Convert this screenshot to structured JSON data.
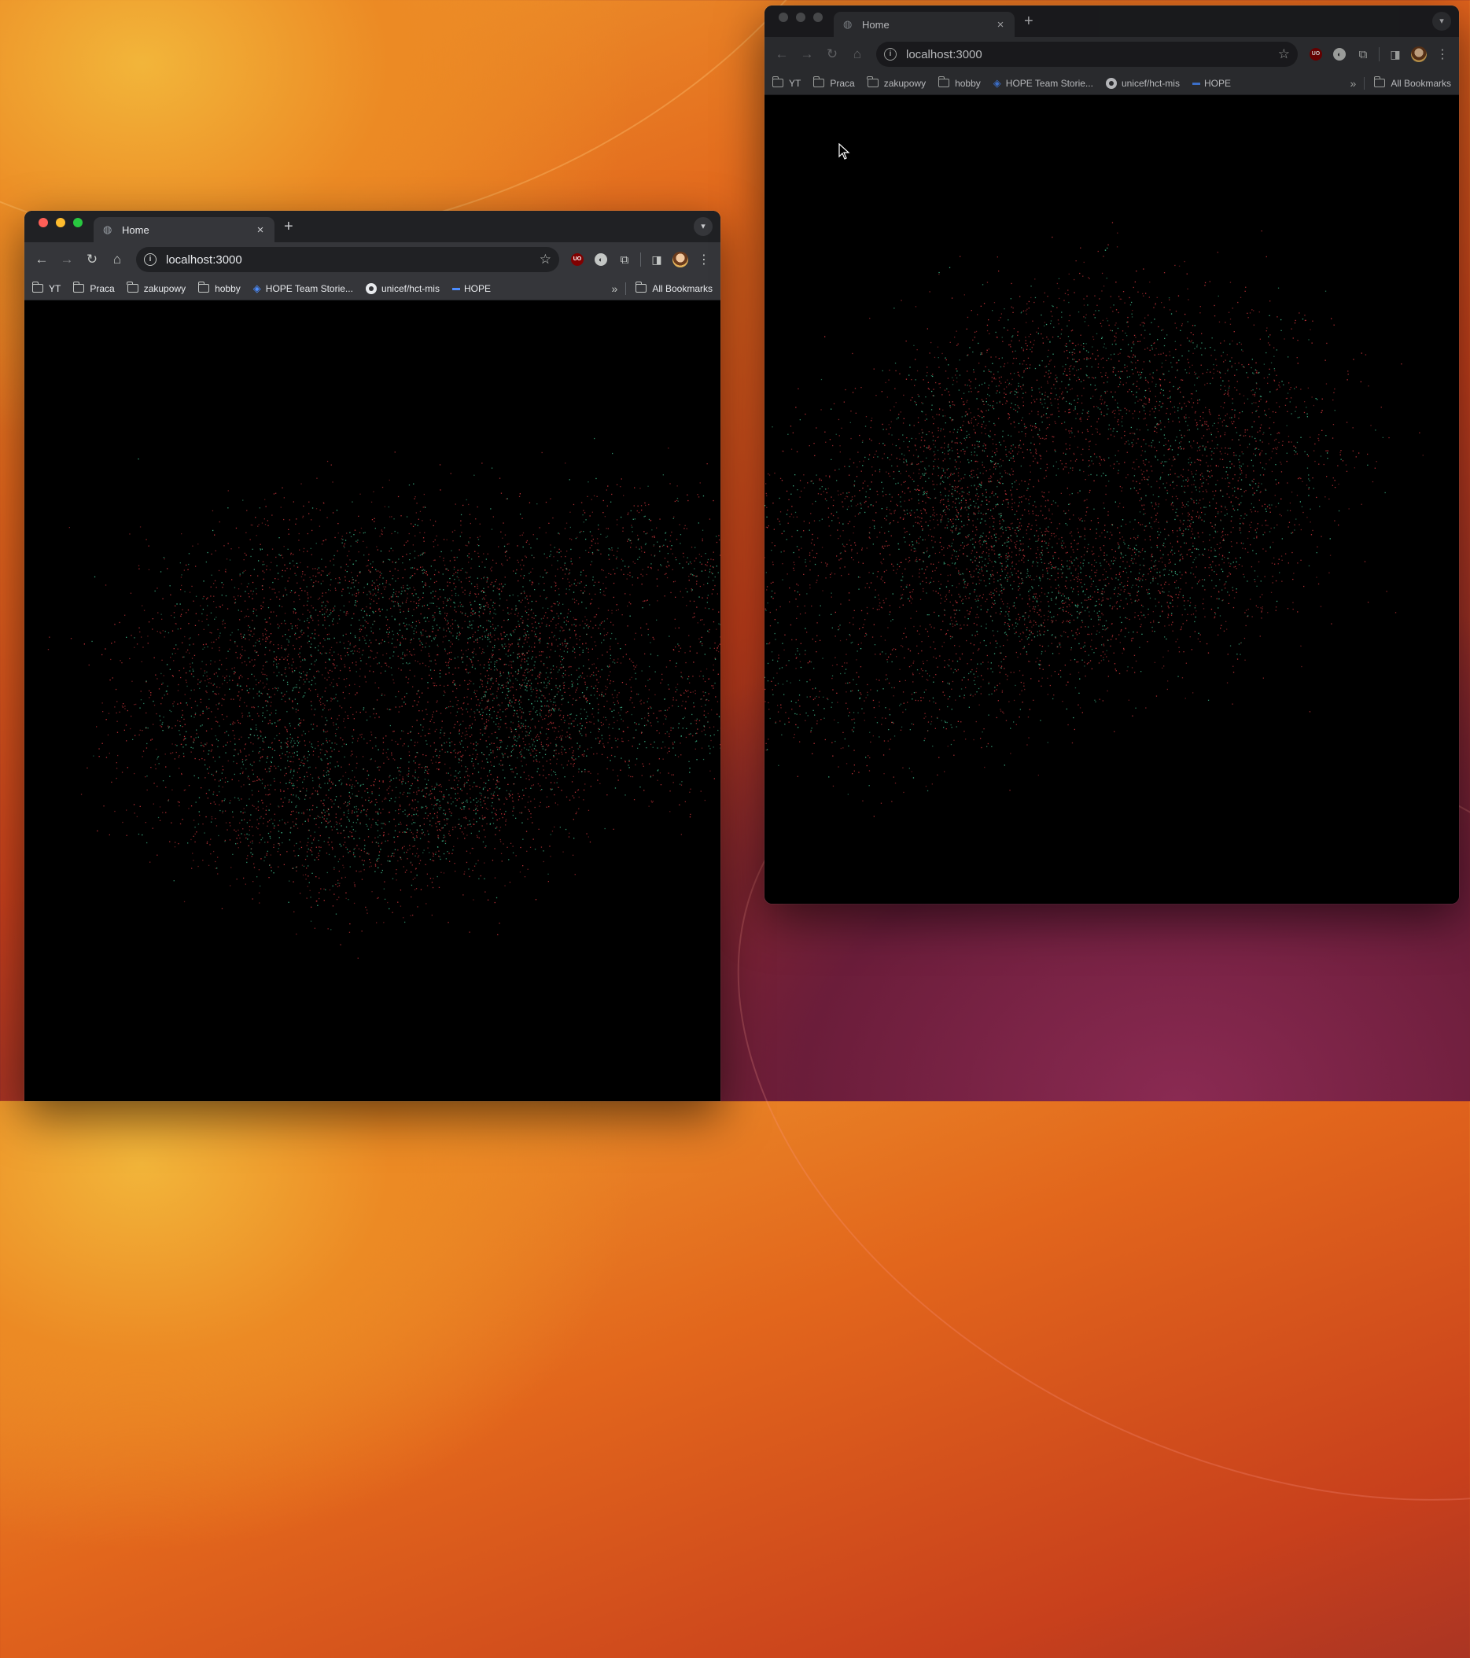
{
  "windows": [
    {
      "tab_title": "Home",
      "url": "localhost:3000",
      "bookmarks": [
        "YT",
        "Praca",
        "zakupowy",
        "hobby",
        "HOPE Team Storie...",
        "unicef/hct-mis",
        "HOPE"
      ],
      "all_bookmarks_label": "All Bookmarks",
      "ublock_label": "UO"
    },
    {
      "tab_title": "Home",
      "url": "localhost:3000",
      "bookmarks": [
        "YT",
        "Praca",
        "zakupowy",
        "hobby",
        "HOPE Team Storie...",
        "unicef/hct-mis",
        "HOPE"
      ],
      "all_bookmarks_label": "All Bookmarks",
      "ublock_label": "UO"
    }
  ],
  "colors": {
    "particle_red": "#c8343a",
    "particle_green": "#3fb98a"
  },
  "icons": {
    "back": "arrow-left-icon",
    "forward": "arrow-right-icon",
    "reload": "reload-icon",
    "home": "home-icon",
    "info": "info-icon",
    "star": "star-icon",
    "extensions": "puzzle-icon",
    "side_panel": "side-panel-icon",
    "menu": "kebab-menu-icon"
  }
}
